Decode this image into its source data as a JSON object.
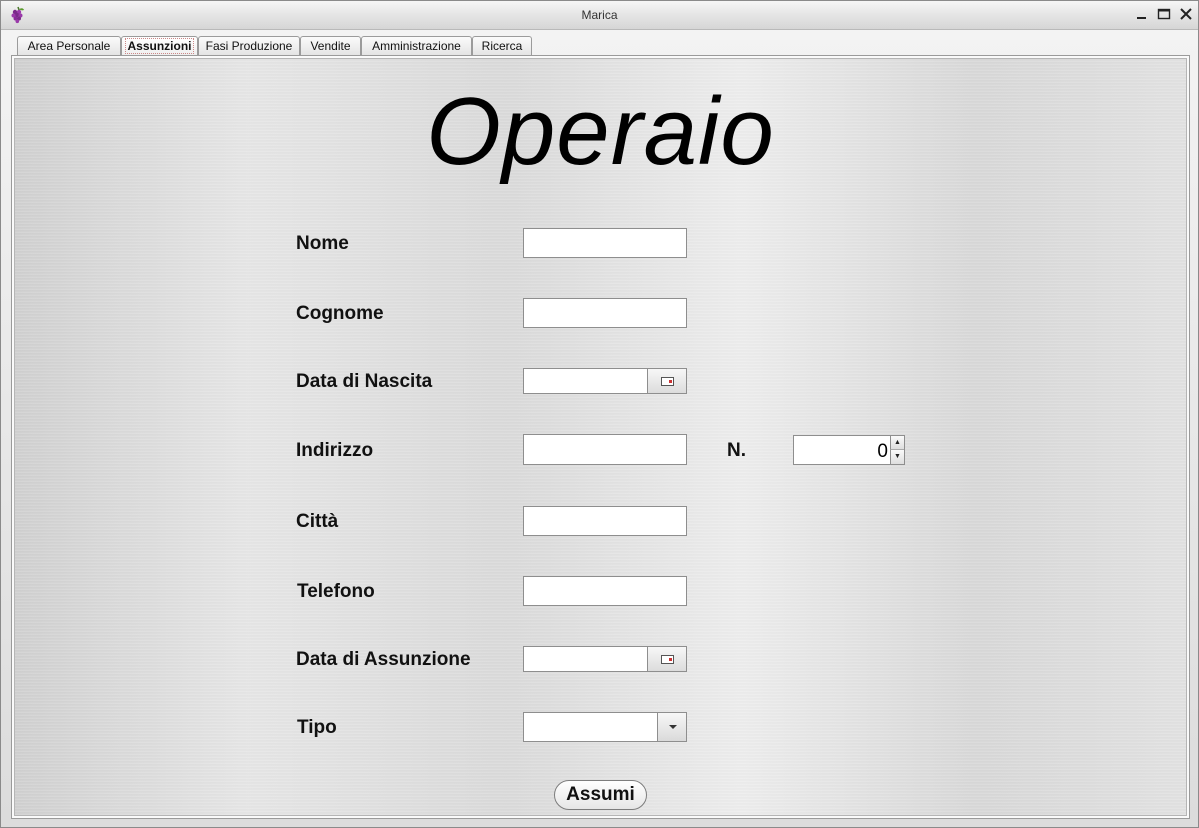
{
  "window": {
    "title": "Marica"
  },
  "tabs": [
    {
      "label": "Area Personale"
    },
    {
      "label": "Assunzioni",
      "active": true
    },
    {
      "label": "Fasi Produzione"
    },
    {
      "label": "Vendite"
    },
    {
      "label": "Amministrazione"
    },
    {
      "label": "Ricerca"
    }
  ],
  "form": {
    "heading": "Operaio",
    "labels": {
      "nome": "Nome",
      "cognome": "Cognome",
      "data_nascita": "Data di Nascita",
      "indirizzo": "Indirizzo",
      "numero": "N.",
      "citta": "Città",
      "telefono": "Telefono",
      "data_assunzione": "Data di Assunzione",
      "tipo": "Tipo"
    },
    "values": {
      "nome": "",
      "cognome": "",
      "data_nascita": "",
      "indirizzo": "",
      "numero": "0",
      "citta": "",
      "telefono": "",
      "data_assunzione": "",
      "tipo": ""
    },
    "submit_label": "Assumi"
  },
  "icons": {
    "app": "grapes-icon",
    "minimize": "minimize-icon",
    "maximize": "maximize-icon",
    "close": "close-icon",
    "calendar": "calendar-icon",
    "spin_up": "arrow-up-icon",
    "spin_down": "arrow-down-icon",
    "dropdown": "chevron-down-icon"
  },
  "colors": {
    "accent": "#8a3aa0",
    "window_bg": "#e0e0e0"
  }
}
